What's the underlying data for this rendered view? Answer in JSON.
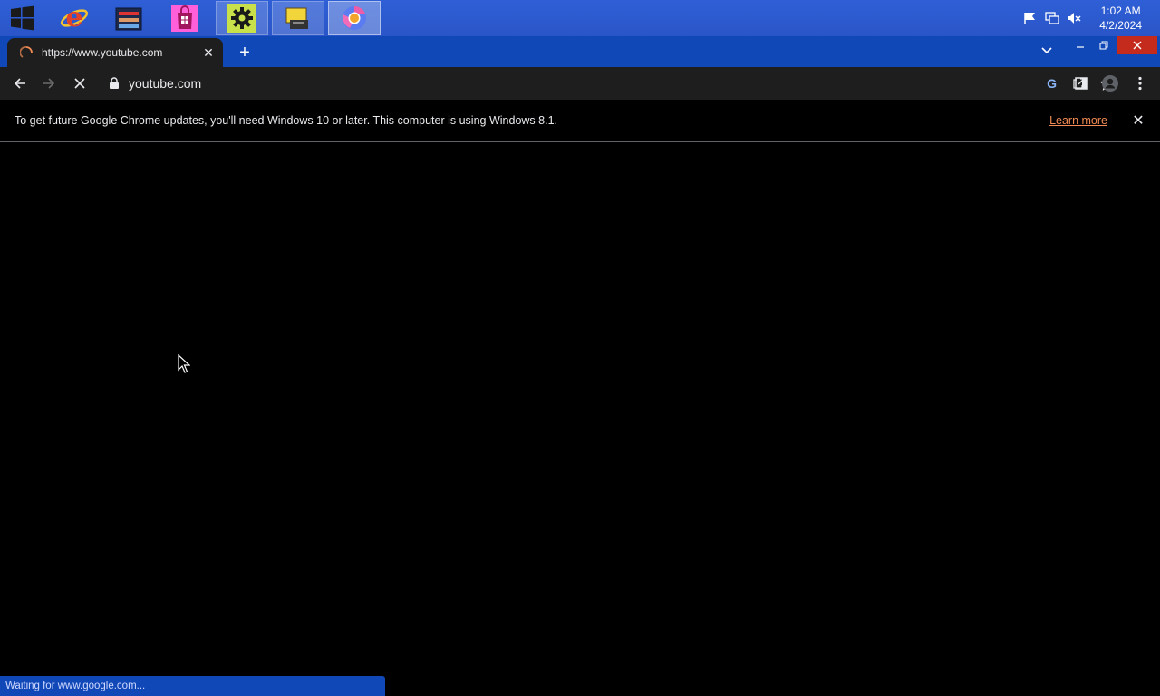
{
  "taskbar": {
    "apps": [
      {
        "name": "internet-explorer"
      },
      {
        "name": "file-manager"
      },
      {
        "name": "store"
      },
      {
        "name": "settings"
      },
      {
        "name": "fax-scanner"
      },
      {
        "name": "chrome"
      }
    ],
    "clock": {
      "time": "1:02 AM",
      "date": "4/2/2024"
    }
  },
  "browser": {
    "tab": {
      "title": "https://www.youtube.com"
    },
    "omnibox": {
      "url": "youtube.com"
    },
    "infobar": {
      "message": "To get future Google Chrome updates, you'll need Windows 10 or later. This computer is using Windows 8.1.",
      "link": "Learn more"
    },
    "status": "Waiting for www.google.com..."
  },
  "colors": {
    "taskbar": "#2a55c8",
    "tabstrip": "#1148b8",
    "toolbar": "#1e1e1e",
    "link": "#f28b54"
  }
}
